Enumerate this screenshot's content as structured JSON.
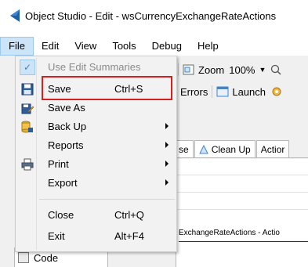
{
  "window": {
    "title": "Object Studio  - Edit - wsCurrencyExchangeRateActions"
  },
  "menubar": {
    "items": [
      {
        "label": "File"
      },
      {
        "label": "Edit"
      },
      {
        "label": "View"
      },
      {
        "label": "Tools"
      },
      {
        "label": "Debug"
      },
      {
        "label": "Help"
      }
    ]
  },
  "toolbar": {
    "zoom_label": "Zoom",
    "zoom_value": "100%",
    "errors_label": ") Errors",
    "launch_label": "Launch"
  },
  "tabs": {
    "items": [
      {
        "label": "se"
      },
      {
        "label": "Clean Up"
      },
      {
        "label": "Actior"
      }
    ]
  },
  "document": {
    "caption": "ExchangeRateActions - Actio"
  },
  "left_pane": {
    "code_label": "Code"
  },
  "file_menu": {
    "items": [
      {
        "label": "Use Edit Summaries",
        "shortcut": "",
        "enabled": false,
        "checked": true,
        "submenu": false,
        "icon": "check-icon"
      },
      {
        "label": "Save",
        "shortcut": "Ctrl+S",
        "enabled": true,
        "checked": false,
        "submenu": false,
        "icon": "save-icon"
      },
      {
        "label": "Save As",
        "shortcut": "",
        "enabled": true,
        "checked": false,
        "submenu": false,
        "icon": "save-as-icon"
      },
      {
        "label": "Back Up",
        "shortcut": "",
        "enabled": true,
        "checked": false,
        "submenu": true,
        "icon": "backup-icon"
      },
      {
        "label": "Reports",
        "shortcut": "",
        "enabled": true,
        "checked": false,
        "submenu": true,
        "icon": ""
      },
      {
        "label": "Print",
        "shortcut": "",
        "enabled": true,
        "checked": false,
        "submenu": true,
        "icon": "print-icon"
      },
      {
        "label": "Export",
        "shortcut": "",
        "enabled": true,
        "checked": false,
        "submenu": true,
        "icon": ""
      },
      {
        "label": "Close",
        "shortcut": "Ctrl+Q",
        "enabled": true,
        "checked": false,
        "submenu": false,
        "icon": ""
      },
      {
        "label": "Exit",
        "shortcut": "Alt+F4",
        "enabled": true,
        "checked": false,
        "submenu": false,
        "icon": ""
      }
    ]
  },
  "colors": {
    "highlight_border": "#d62020",
    "menu_bg": "#f2f2f2",
    "active_menu_bg": "#cce4f7",
    "app_icon": "#1f5fa8"
  }
}
